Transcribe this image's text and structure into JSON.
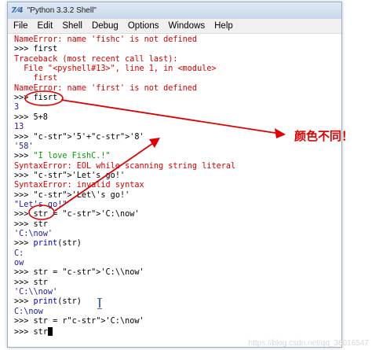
{
  "window": {
    "title": "\"Python 3.3.2 Shell\"",
    "icon": "python-logo"
  },
  "menu": [
    "File",
    "Edit",
    "Shell",
    "Debug",
    "Options",
    "Windows",
    "Help"
  ],
  "lines": [
    {
      "text": "NameError: name 'fishc' is not defined",
      "kind": "err"
    },
    {
      "text": ">>> first",
      "kind": "in"
    },
    {
      "text": "Traceback (most recent call last):",
      "kind": "err"
    },
    {
      "text": "  File \"<pyshell#13>\", line 1, in <module>",
      "kind": "err"
    },
    {
      "text": "    first",
      "kind": "err"
    },
    {
      "text": "NameError: name 'first' is not defined",
      "kind": "err"
    },
    {
      "text": ">>> fisrt",
      "kind": "in"
    },
    {
      "text": "3",
      "kind": "out"
    },
    {
      "text": ">>> 5+8",
      "kind": "in"
    },
    {
      "text": "13",
      "kind": "out"
    },
    {
      "text": ">>> '5'+'8'",
      "kind": "in"
    },
    {
      "text": "'58'",
      "kind": "out"
    },
    {
      "text": ">>> \"I love FishC.!\"",
      "kind": "in"
    },
    {
      "text": "SyntaxError: EOL while scanning string literal",
      "kind": "err"
    },
    {
      "text": ">>> 'Let's go!'",
      "kind": "in"
    },
    {
      "text": "SyntaxError: invalid syntax",
      "kind": "err"
    },
    {
      "text": ">>> 'Let\\'s go!'",
      "kind": "in"
    },
    {
      "text": "\"Let's go!\"",
      "kind": "out"
    },
    {
      "text": ">>> str = 'C:\\now'",
      "kind": "in"
    },
    {
      "text": ">>> str",
      "kind": "in"
    },
    {
      "text": "'C:\\now'",
      "kind": "out"
    },
    {
      "text": ">>> print(str)",
      "kind": "in"
    },
    {
      "text": "C:",
      "kind": "out"
    },
    {
      "text": "ow",
      "kind": "out"
    },
    {
      "text": ">>> str = 'C:\\\\now'",
      "kind": "in"
    },
    {
      "text": ">>> str",
      "kind": "in"
    },
    {
      "text": "'C:\\\\now'",
      "kind": "out"
    },
    {
      "text": ">>> print(str)",
      "kind": "in"
    },
    {
      "text": "C:\\now",
      "kind": "out"
    },
    {
      "text": ">>> str = r'C:\\now'",
      "kind": "in"
    },
    {
      "text": ">>> str",
      "kind": "in"
    }
  ],
  "annotation": {
    "label": "颜色不同！",
    "color": "#e00000"
  },
  "watermark": "https://blog.csdn.net/qq_38016547",
  "colors": {
    "error": "#d60000",
    "string": "#00a000",
    "keyword": "#0000c8",
    "output": "#1a1aa8"
  }
}
